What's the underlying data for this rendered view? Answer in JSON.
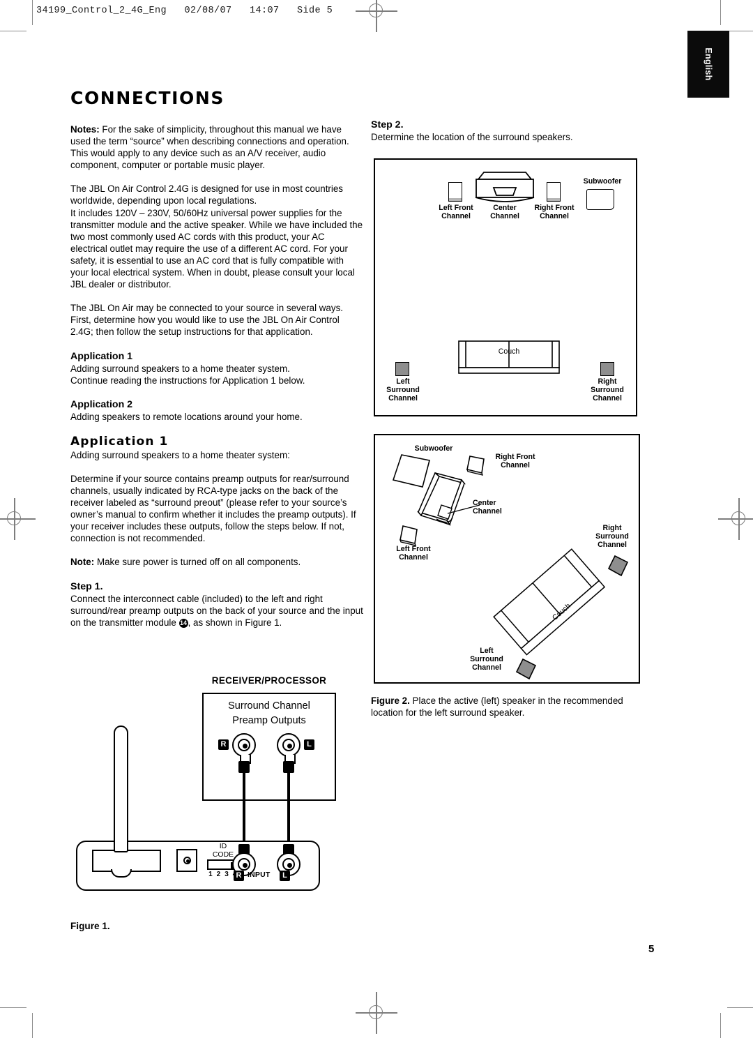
{
  "prepress": {
    "slug": "34199_Control_2_4G_Eng   02/08/07   14:07   Side 5"
  },
  "tab": {
    "language": "English"
  },
  "page": {
    "number": "5"
  },
  "left_column": {
    "section_title": "CONNECTIONS",
    "notes_label": "Notes:",
    "notes_text": " For the sake of simplicity, throughout this manual we have used the term “source” when describing connections and operation. This would apply to any device such as an A/V receiver, audio component, computer or portable music player.",
    "para_countries": "The JBL On Air Control 2.4G is designed for use in most countries worldwide, depending upon local regulations.",
    "para_power": "It includes 120V – 230V, 50/60Hz universal power supplies for the transmitter module and the active speaker. While we have included the two most commonly used AC cords with this product, your AC electrical outlet may require the use of a different AC cord. For your safety, it is essential to use an AC cord that is fully compatible with your local electrical system. When in doubt, please consult your local JBL dealer or distributor.",
    "para_ways": "The JBL On Air may be connected to your source in several ways. First, determine how you would like to use the JBL On Air Control 2.4G; then follow the setup instructions for that application.",
    "application1_heading": "Application 1",
    "application1_line1": "Adding surround speakers to a home theater system.",
    "application1_line2": "Continue reading the instructions for Application 1 below.",
    "application2_heading": "Application 2",
    "application2_line1": "Adding speakers to remote locations around your home.",
    "application1_title": "Application 1",
    "application1_subtitle": "Adding surround speakers to a home theater system:",
    "para_determine": "Determine if your source contains preamp outputs for rear/surround channels, usually indicated by RCA-type jacks on the back of the receiver labeled as “surround preout” (please refer to your source’s owner’s manual to confirm whether it includes the preamp outputs). If your receiver includes these outputs, follow the steps below. If not, connection is not recommended.",
    "note_label": "Note:",
    "note_text": " Make sure power is turned off on all components.",
    "step1_label": "Step 1.",
    "step1_text_a": "Connect the interconnect cable (included) to the left and right surround/rear preamp outputs on the back of your source and the input on the transmitter module ",
    "step1_callout": "14",
    "step1_text_b": ", as shown in Figure 1."
  },
  "figure1": {
    "caption": "Figure 1.",
    "receiver_title": "RECEIVER/PROCESSOR",
    "receiver_sub_line1": "Surround Channel",
    "receiver_sub_line2": "Preamp Outputs",
    "jack_r": "R",
    "jack_l": "L",
    "id_code_line1": "ID",
    "id_code_line2": "CODE",
    "dip_numbers": "1 2 3 4",
    "input_r": "R",
    "input_label": "INPUT",
    "input_l": "L"
  },
  "right_column": {
    "step2_label": "Step 2.",
    "step2_text": "Determine the location of the surround speakers.",
    "figure2_caption_label": "Figure 2.",
    "figure2_caption_text": " Place the active (left) speaker in the recommended location for the left surround speaker."
  },
  "room_diagram_1": {
    "left_front": "Left Front\nChannel",
    "left_front_l1": "Left Front",
    "left_front_l2": "Channel",
    "center_l1": "Center",
    "center_l2": "Channel",
    "right_front_l1": "Right Front",
    "right_front_l2": "Channel",
    "subwoofer": "Subwoofer",
    "couch": "Couch",
    "left_surround_l1": "Left",
    "left_surround_l2": "Surround",
    "left_surround_l3": "Channel",
    "right_surround_l1": "Right",
    "right_surround_l2": "Surround",
    "right_surround_l3": "Channel"
  },
  "room_diagram_2": {
    "subwoofer": "Subwoofer",
    "right_front_l1": "Right Front",
    "right_front_l2": "Channel",
    "center_l1": "Center",
    "center_l2": "Channel",
    "left_front_l1": "Left Front",
    "left_front_l2": "Channel",
    "right_surround_l1": "Right",
    "right_surround_l2": "Surround",
    "right_surround_l3": "Channel",
    "left_surround_l1": "Left",
    "left_surround_l2": "Surround",
    "left_surround_l3": "Channel",
    "couch": "Couch"
  },
  "colors": {
    "ink": "#000000",
    "speaker_gray": "#8e8e8e",
    "mark_gray": "#7d7d7d"
  }
}
